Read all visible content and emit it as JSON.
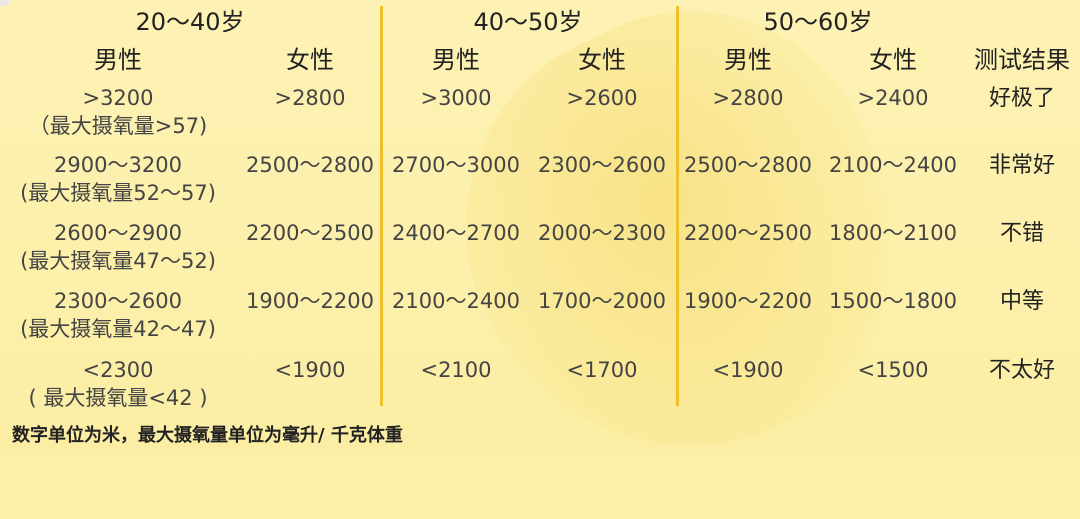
{
  "headers": {
    "age_groups": [
      "20～40岁",
      "40～50岁",
      "50～60岁"
    ],
    "male": "男性",
    "female": "女性",
    "result": "测试结果"
  },
  "rows": [
    {
      "m2040": ">3200",
      "m2040_sub": "（最大摄氧量>57)",
      "f2040": ">2800",
      "m4050": ">3000",
      "f4050": ">2600",
      "m5060": ">2800",
      "f5060": ">2400",
      "result": "好极了"
    },
    {
      "m2040": "2900～3200",
      "m2040_sub": "(最大摄氧量52～57)",
      "f2040": "2500～2800",
      "m4050": "2700～3000",
      "f4050": "2300～2600",
      "m5060": "2500～2800",
      "f5060": "2100～2400",
      "result": "非常好"
    },
    {
      "m2040": "2600～2900",
      "m2040_sub": "(最大摄氧量47～52)",
      "f2040": "2200～2500",
      "m4050": "2400～2700",
      "f4050": "2000～2300",
      "m5060": "2200～2500",
      "f5060": "1800～2100",
      "result": "不错"
    },
    {
      "m2040": "2300～2600",
      "m2040_sub": "(最大摄氧量42～47)",
      "f2040": "1900～2200",
      "m4050": "2100～2400",
      "f4050": "1700～2000",
      "m5060": "1900～2200",
      "f5060": "1500～1800",
      "result": "中等"
    },
    {
      "m2040": "<2300",
      "m2040_sub": "( 最大摄氧量<42 )",
      "f2040": "<1900",
      "m4050": "<2100",
      "f4050": "<1700",
      "m5060": "<1900",
      "f5060": "<1500",
      "result": "不太好"
    }
  ],
  "footnote": "数字单位为米，最大摄氧量单位为毫升/ 千克体重"
}
